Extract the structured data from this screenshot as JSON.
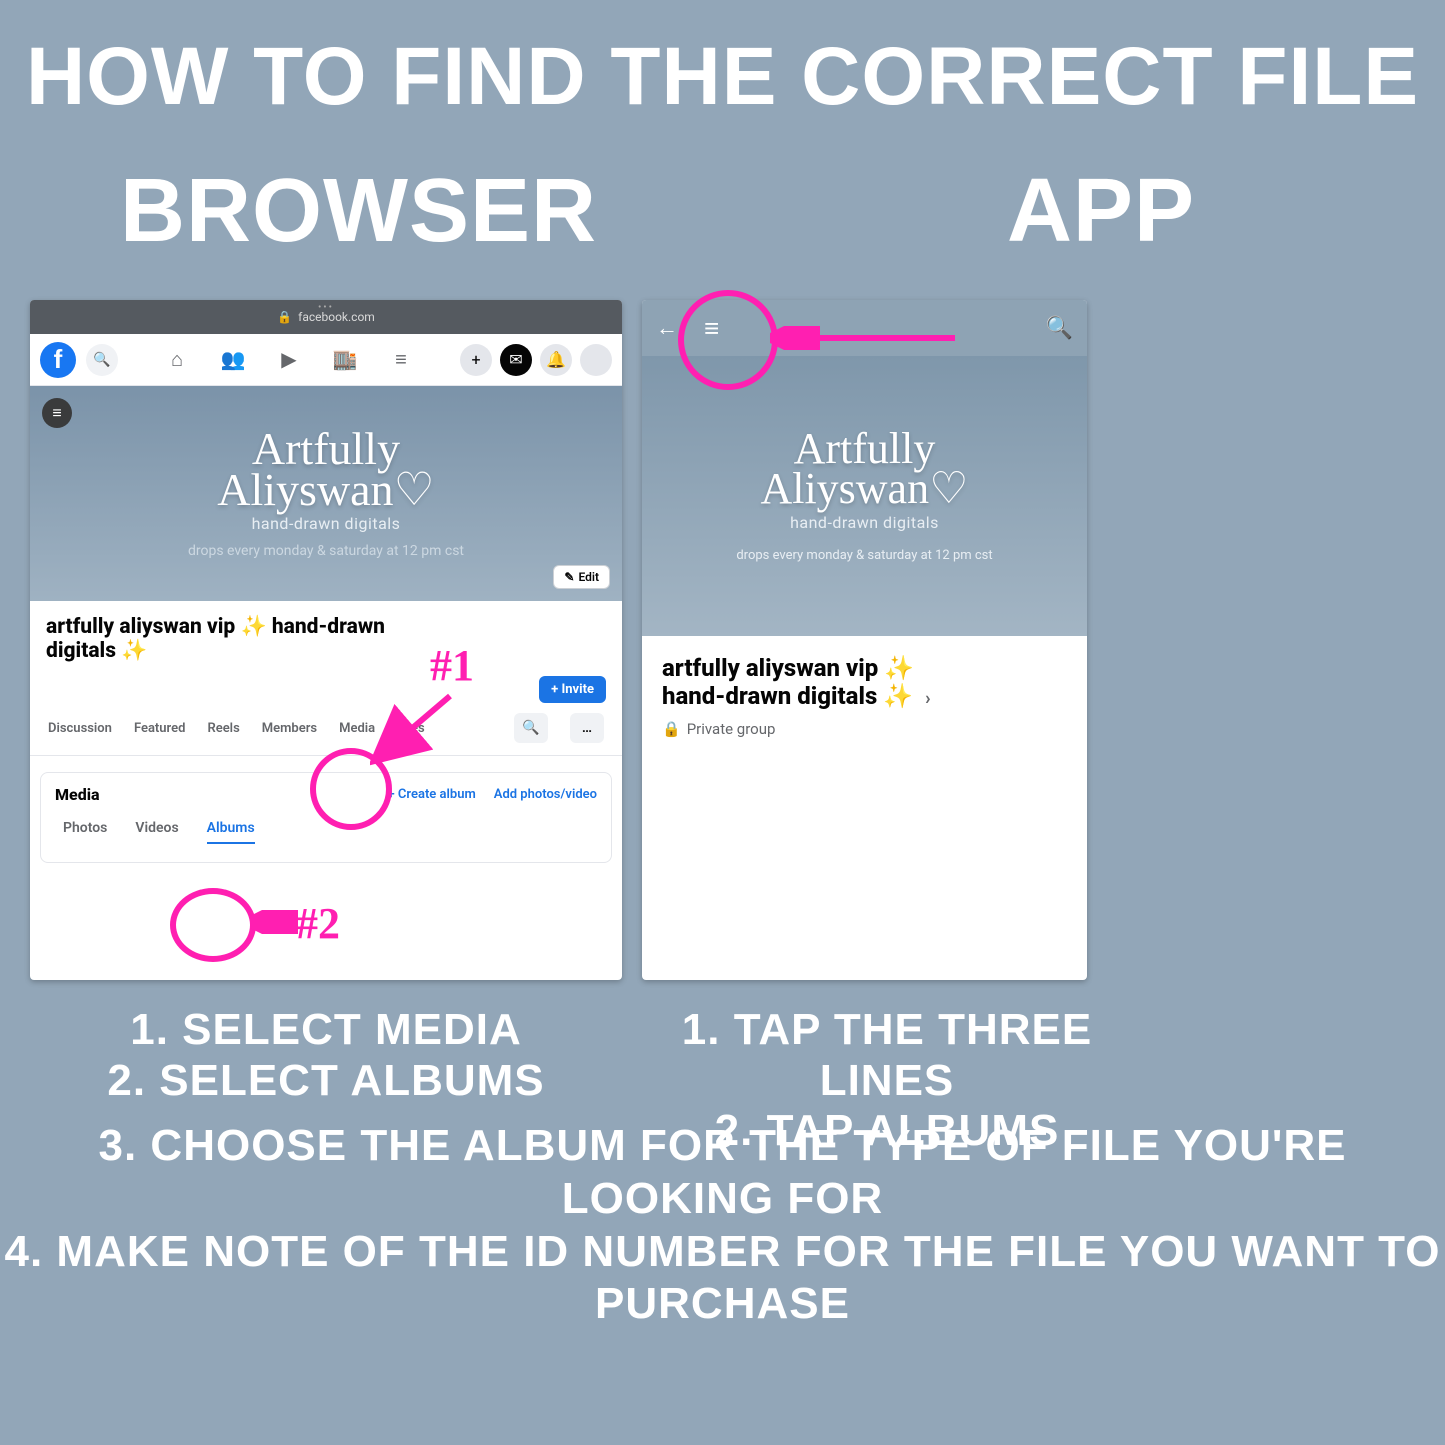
{
  "headline": "HOW TO FIND THE CORRECT FILE",
  "col_left_title": "BROWSER",
  "col_right_title": "APP",
  "browser": {
    "url_host": "facebook.com",
    "cover": {
      "brand_line1": "Artfully",
      "brand_line2": "Aliyswan♡",
      "sub1": "hand-drawn digitals",
      "sub2": "drops every monday & saturday at 12 pm cst",
      "edit_label": "Edit"
    },
    "group_name": "artfully aliyswan vip ✨ hand-drawn digitals ✨",
    "invite_label": "+ Invite",
    "tabs": {
      "discussion": "Discussion",
      "featured": "Featured",
      "reels": "Reels",
      "members": "Members",
      "media": "Media",
      "files": "Files"
    },
    "media_card": {
      "title": "Media",
      "create_album": "+  Create album",
      "add_photos": "Add photos/video",
      "subtabs": {
        "photos": "Photos",
        "videos": "Videos",
        "albums": "Albums"
      }
    }
  },
  "app": {
    "cover": {
      "brand_line1": "Artfully",
      "brand_line2": "Aliyswan♡",
      "sub1": "hand-drawn digitals",
      "sub2": "drops every monday & saturday at 12 pm cst"
    },
    "group_name_l1": "artfully aliyswan vip ✨",
    "group_name_l2": "hand-drawn digitals ✨",
    "privacy": "Private group"
  },
  "annotations": {
    "one": "#1",
    "two": "#2"
  },
  "instructions": {
    "left1": "1. SELECT MEDIA",
    "left2": "2. SELECT ALBUMS",
    "right1": "1. TAP THE THREE LINES",
    "right2": "2. TAP ALBUMS",
    "wide3": "3. CHOOSE THE ALBUM FOR THE TYPE OF FILE YOU'RE LOOKING FOR",
    "wide4": "4. MAKE NOTE OF THE ID NUMBER FOR THE FILE YOU WANT TO PURCHASE"
  }
}
